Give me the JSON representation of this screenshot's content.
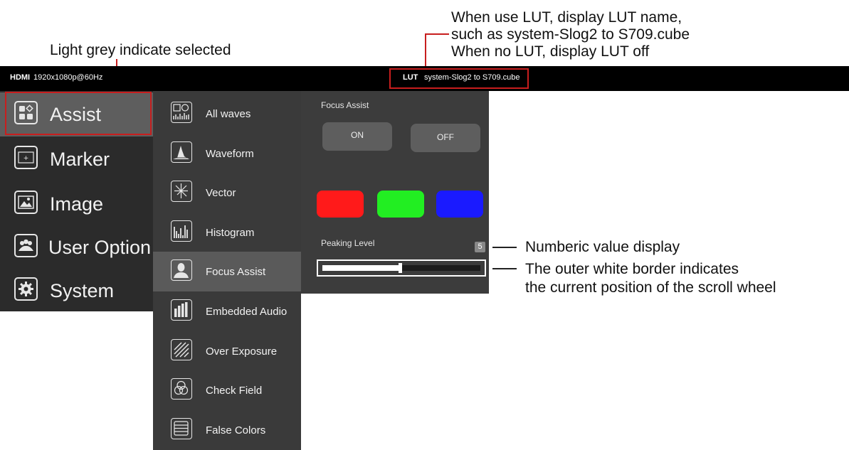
{
  "annotations": {
    "selected_note": "Light grey indicate selected",
    "lut_note": [
      "When use LUT, display LUT name,",
      "such as system-Slog2 to S709.cube",
      "When no LUT, display LUT off"
    ],
    "value_note": "Numberic value display",
    "border_note": [
      "The outer white border indicates",
      "the current position of the scroll wheel"
    ]
  },
  "topbar": {
    "source": "HDMI",
    "resolution": "1920x1080p@60Hz",
    "lut_label": "LUT",
    "lut_name": "system-Slog2 to S709.cube"
  },
  "main_menu": [
    {
      "label": "Assist",
      "icon": "assist-icon",
      "selected": true
    },
    {
      "label": "Marker",
      "icon": "marker-icon",
      "selected": false
    },
    {
      "label": "Image",
      "icon": "image-icon",
      "selected": false
    },
    {
      "label": "User Option",
      "icon": "users-icon",
      "selected": false
    },
    {
      "label": "System",
      "icon": "gear-icon",
      "selected": false
    }
  ],
  "sub_menu": [
    {
      "label": "All waves",
      "icon": "all-waves-icon"
    },
    {
      "label": "Waveform",
      "icon": "waveform-icon"
    },
    {
      "label": "Vector",
      "icon": "vector-icon"
    },
    {
      "label": "Histogram",
      "icon": "histogram-icon"
    },
    {
      "label": "Focus Assist",
      "icon": "focus-assist-icon",
      "selected": true
    },
    {
      "label": "Embedded Audio",
      "icon": "audio-icon"
    },
    {
      "label": "Over Exposure",
      "icon": "over-exposure-icon"
    },
    {
      "label": "Check Field",
      "icon": "check-field-icon"
    },
    {
      "label": "False Colors",
      "icon": "false-colors-icon"
    }
  ],
  "panel": {
    "title": "Focus Assist",
    "on_label": "ON",
    "off_label": "OFF",
    "colors": [
      "#ff1a1a",
      "#22ee22",
      "#1a1aff"
    ],
    "peaking_label": "Peaking Level",
    "peaking_value": "5",
    "peaking_fraction": 0.5
  }
}
